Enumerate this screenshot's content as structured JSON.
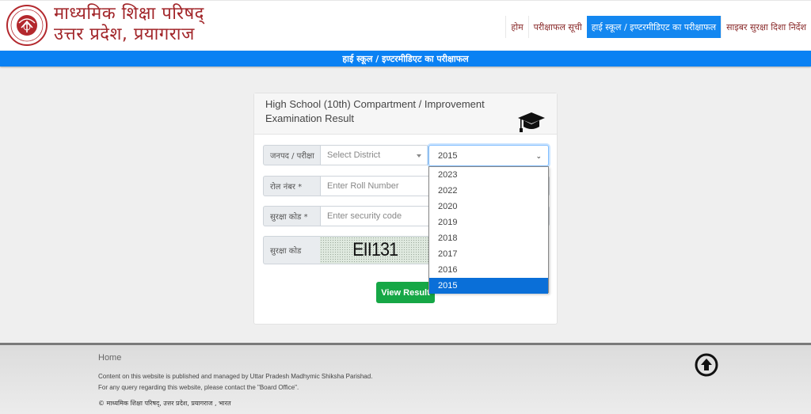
{
  "header": {
    "brand_line1": "माध्यमिक शिक्षा परिषद्",
    "brand_line2": "उत्तर प्रदेश, प्रयागराज",
    "logo": "up-board-emblem",
    "nav": [
      {
        "label": "होम",
        "active": false
      },
      {
        "label": "परीक्षाफल सूची",
        "active": false
      },
      {
        "label": "हाई स्कूल / इण्टरमीडिएट का परीक्षाफल",
        "active": true
      },
      {
        "label": "साइबर सुरक्षा दिशा निर्देश",
        "active": false
      }
    ]
  },
  "banner": {
    "title": "हाई स्कूल / इण्टरमीडिएट का परीक्षाफल"
  },
  "card": {
    "title": "High School (10th) Compartment / Improvement Examination Result",
    "icon": "graduation-cap-icon",
    "district": {
      "label": "जनपद / परीक्षा",
      "placeholder": "Select District"
    },
    "year": {
      "selected": "2015",
      "options": [
        "2023",
        "2022",
        "2020",
        "2019",
        "2018",
        "2017",
        "2016",
        "2015"
      ]
    },
    "roll": {
      "label": "रोल नंबर *",
      "placeholder": "Enter Roll Number"
    },
    "security_input": {
      "label": "सुरक्षा कोड *",
      "placeholder": "Enter security code"
    },
    "captcha": {
      "label": "सुरक्षा कोड",
      "text": "EII131"
    },
    "submit_label": "View Result"
  },
  "footer": {
    "home_link": "Home",
    "line1": "Content on this website is published and managed by Uttar Pradesh Madhymic Shiksha Parishad.",
    "line2": "For any query regarding this website, please contact the \"Board Office\".",
    "copyright": "© माध्यमिक शिक्षा परिषद्, उत्तर प्रदेश, प्रयागराज , भारत",
    "scroll_top_icon": "arrow-up-circle-icon"
  },
  "colors": {
    "brand": "#a2262a",
    "primary": "#0a81f3",
    "success": "#16a746"
  }
}
